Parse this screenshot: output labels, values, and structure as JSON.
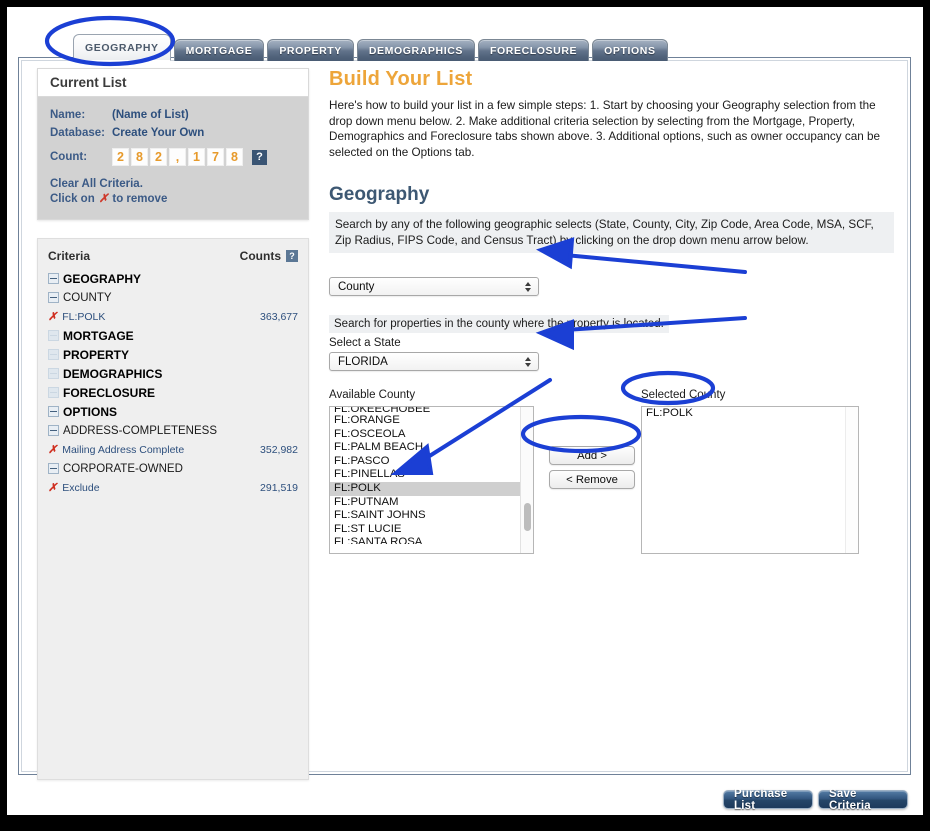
{
  "tabs": [
    {
      "id": "geography",
      "label": "GEOGRAPHY",
      "active": true
    },
    {
      "id": "mortgage",
      "label": "MORTGAGE",
      "active": false
    },
    {
      "id": "property",
      "label": "PROPERTY",
      "active": false
    },
    {
      "id": "demographics",
      "label": "DEMOGRAPHICS",
      "active": false
    },
    {
      "id": "foreclosure",
      "label": "FORECLOSURE",
      "active": false
    },
    {
      "id": "options",
      "label": "OPTIONS",
      "active": false
    }
  ],
  "current_list": {
    "title": "Current List",
    "name_label": "Name:",
    "name_value": "(Name of List)",
    "database_label": "Database:",
    "database_value": "Create Your Own",
    "count_label": "Count:",
    "count_value": "282,178",
    "count_digits": [
      "2",
      "8",
      "2",
      ",",
      "1",
      "7",
      "8"
    ],
    "help_glyph": "?",
    "clear_line1": "Clear All Criteria.",
    "clear_line2_pre": "Click on",
    "clear_line2_x": "✗",
    "clear_line2_post": "to remove"
  },
  "criteria_panel": {
    "header_criteria": "Criteria",
    "header_counts": "Counts",
    "help_glyph": "?",
    "rows": [
      {
        "level": 0,
        "toggle": "minus",
        "label": "GEOGRAPHY",
        "count": "",
        "x": false
      },
      {
        "level": 1,
        "toggle": "minus",
        "label": "COUNTY",
        "count": "",
        "x": false
      },
      {
        "level": 2,
        "toggle": "none",
        "label": "FL:POLK",
        "count": "363,677",
        "x": true
      },
      {
        "level": 0,
        "toggle": "plus",
        "label": "MORTGAGE",
        "count": "",
        "x": false
      },
      {
        "level": 0,
        "toggle": "plus",
        "label": "PROPERTY",
        "count": "",
        "x": false
      },
      {
        "level": 0,
        "toggle": "plus",
        "label": "DEMOGRAPHICS",
        "count": "",
        "x": false
      },
      {
        "level": 0,
        "toggle": "plus",
        "label": "FORECLOSURE",
        "count": "",
        "x": false
      },
      {
        "level": 0,
        "toggle": "minus",
        "label": "OPTIONS",
        "count": "",
        "x": false
      },
      {
        "level": 1,
        "toggle": "minus",
        "label": "ADDRESS-COMPLETENESS",
        "count": "",
        "x": false
      },
      {
        "level": 2,
        "toggle": "none",
        "label": "Mailing Address Complete",
        "count": "352,982",
        "x": true
      },
      {
        "level": 1,
        "toggle": "minus",
        "label": "CORPORATE-OWNED",
        "count": "",
        "x": false
      },
      {
        "level": 2,
        "toggle": "none",
        "label": "Exclude",
        "count": "291,519",
        "x": true
      }
    ]
  },
  "main": {
    "title": "Build Your List",
    "intro": "Here's how to build your list in a few simple steps: 1. Start by choosing your Geography selection from the drop down menu below. 2. Make additional criteria selection by selecting from the Mortgage, Property, Demographics and Foreclosure tabs shown above. 3. Additional options, such as owner occupancy can be selected on the Options tab.",
    "section_title": "Geography",
    "section_note": "Search by any of the following geographic selects (State, County, City, Zip Code, Area Code, MSA, SCF, Zip Radius, FIPS Code, and Census Tract) by clicking on the drop down menu arrow below.",
    "geo_select_value": "County",
    "geo_hint": "Search for properties in the county where the property is located.",
    "state_label": "Select a State",
    "state_select_value": "FLORIDA",
    "available_label": "Available County",
    "selected_label": "Selected County",
    "available_options": [
      "FL:OKEECHOBEE",
      "FL:ORANGE",
      "FL:OSCEOLA",
      "FL:PALM BEACH",
      "FL:PASCO",
      "FL:PINELLAS",
      "FL:POLK",
      "FL:PUTNAM",
      "FL:SAINT JOHNS",
      "FL:ST LUCIE",
      "FL:SANTA ROSA"
    ],
    "available_selected": "FL:POLK",
    "selected_options": [
      "FL:POLK"
    ],
    "add_button": "Add >",
    "remove_button": "< Remove"
  },
  "footer": {
    "purchase_button": "Purchase List",
    "save_button": "Save Criteria"
  },
  "colors": {
    "accent_orange": "#eda53a",
    "heading_blue": "#3d5873",
    "tab_blue": "#62738b",
    "annotation_blue": "#1b3fd4",
    "link_blue": "#2d4f7d",
    "x_red": "#cf2f20",
    "button_blue": "#32557e"
  }
}
